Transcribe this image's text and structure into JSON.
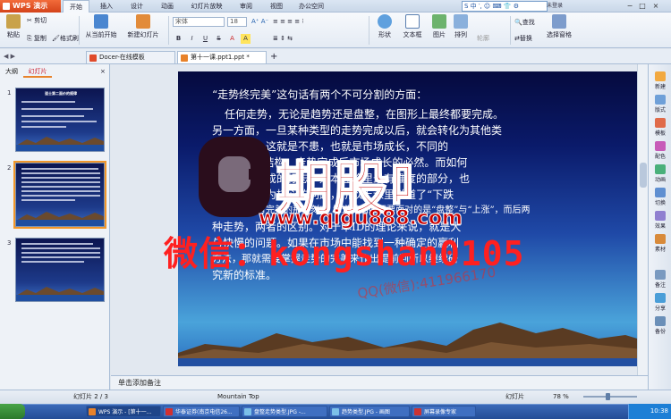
{
  "window": {
    "app_button": "WPS 演示",
    "menu_tabs": [
      "开始",
      "插入",
      "设计",
      "动画",
      "幻灯片放映",
      "审阅",
      "视图",
      "办公空间"
    ],
    "ime_text": "S 中 ′, ☺ ⌨ 👕 ⚙",
    "unregistered": "未登录",
    "controls": [
      "−",
      "□",
      "×"
    ]
  },
  "ribbon": {
    "paste": "粘贴",
    "cut": "剪切",
    "copy": "复制",
    "format_painter": "格式刷",
    "from_current": "从当前开始",
    "new_slide": "新建幻灯片",
    "font_name": "宋体",
    "font_size": "18",
    "format_buttons": [
      "B",
      "I",
      "U",
      "S",
      "A",
      "A"
    ],
    "shapes": "形状",
    "textbox": "文本框",
    "picture": "图片",
    "arrange": "排列",
    "outline": "轮廓",
    "find": "查找",
    "replace": "替换",
    "select_pane": "选择窗格"
  },
  "doc_tabs": [
    "Docer-在线模板",
    "第十一课.ppt1.ppt *"
  ],
  "left_panel": {
    "tabs": [
      "大纲",
      "幻灯片"
    ],
    "slide_numbers": [
      "1",
      "2",
      "3"
    ],
    "thumb1_title": "道士第二面价的规律"
  },
  "slide": {
    "lines": [
      "“走势终完美”这句话有两个不可分割的方面：",
      "任何走势，无论是趋势还是盘整，在图形上最终都要完成。",
      "另一方面，一旦某种类型的走势完成以后，就会转化为其他类",
      "型的走势，这就是不患，也就是市场成长，不同的",
      "级别(次级)结构，走势完成后市场成长的必然。而如何",
      "看待走势完成的标志，是本理论里最有难度的部分，也",
      "就是一个最为核心的问题，所以上课里说道了“下跌",
      "走势最终都有完美的那一刻”，知道随后必须要面对的是“盘整”与“上涨”，而后两",
      "种走势，两者的区别。对于本ID的理论来说，就是大",
      "与快慢的问题。如果在市场中能找到一种确定的赢利",
      "方法，那就需要掌握走势的完美来作出提前判断以继续研",
      "究新的标准。"
    ]
  },
  "watermark": {
    "logo_text": "期股吧",
    "site": "www.qigu888.com",
    "wechat": "微信：kongshan0105",
    "qq": "QQ(微信):411966170"
  },
  "notes_placeholder": "单击添加备注",
  "right_sidebar": [
    "新建",
    "版式",
    "模板",
    "配色",
    "动画",
    "切换",
    "效果",
    "素材",
    "备注",
    "分享",
    "备份"
  ],
  "status": {
    "slide_count": "幻灯片 2 / 3",
    "theme": "Mountain Top",
    "right_label": "幻灯片",
    "zoom": "78 %"
  },
  "taskbar": {
    "items": [
      "WPS 演示 - [第十一...",
      "华泰证券(南京电信26...",
      "盘整走势类型.JPG -...",
      "趋势类型.JPG - 画图",
      "屏幕录像专家"
    ],
    "clock": "10:38"
  },
  "colors": {
    "accent_orange": "#e8822a",
    "watermark_red": "#ff2020"
  }
}
